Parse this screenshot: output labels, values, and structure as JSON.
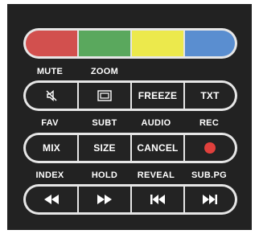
{
  "color_row": {
    "colors": [
      "#d2504e",
      "#5aa85d",
      "#ece94c",
      "#5a8ed0"
    ],
    "names": [
      "red-key-button",
      "green-key-button",
      "yellow-key-button",
      "blue-key-button"
    ]
  },
  "row1": {
    "labels": [
      "MUTE",
      "ZOOM",
      "",
      ""
    ],
    "buttons": [
      {
        "icon": "mute-icon",
        "text": ""
      },
      {
        "icon": "zoom-icon",
        "text": ""
      },
      {
        "icon": "",
        "text": "FREEZE"
      },
      {
        "icon": "",
        "text": "TXT"
      }
    ]
  },
  "row2": {
    "labels": [
      "FAV",
      "SUBT",
      "AUDIO",
      "REC"
    ],
    "buttons": [
      {
        "icon": "",
        "text": "MIX"
      },
      {
        "icon": "",
        "text": "SIZE"
      },
      {
        "icon": "",
        "text": "CANCEL"
      },
      {
        "icon": "record-icon",
        "text": "",
        "color": "#e0403c"
      }
    ]
  },
  "row3": {
    "labels": [
      "INDEX",
      "HOLD",
      "REVEAL",
      "SUB.PG"
    ],
    "buttons": [
      {
        "icon": "rewind-icon",
        "text": ""
      },
      {
        "icon": "fast-forward-icon",
        "text": ""
      },
      {
        "icon": "previous-icon",
        "text": ""
      },
      {
        "icon": "next-icon",
        "text": ""
      }
    ]
  }
}
